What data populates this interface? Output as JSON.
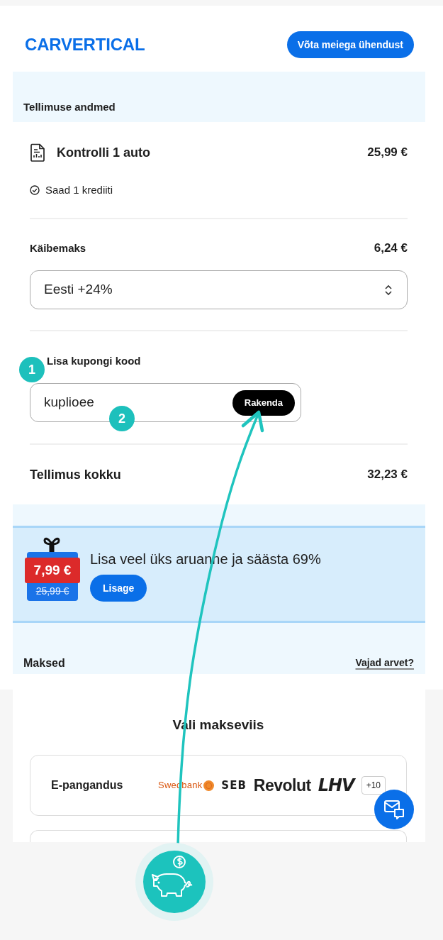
{
  "header": {
    "logo": "CARVERTICAL",
    "contact_button": "Võta meiega ühendust"
  },
  "order": {
    "title": "Tellimuse andmed",
    "product": {
      "name": "Kontrolli 1 auto",
      "price": "25,99 €",
      "note": "Saad 1 krediiti"
    },
    "vat": {
      "label": "Käibemaks",
      "amount": "6,24 €",
      "select_value": "Eesti +24%"
    },
    "coupon": {
      "label": "Lisa kupongi kood",
      "value": "kuplioee",
      "apply_button": "Rakenda"
    },
    "total": {
      "label": "Tellimus kokku",
      "amount": "32,23 €"
    }
  },
  "offer": {
    "new_price": "7,99 €",
    "old_price": "25,99 €",
    "text": "Lisa veel üks aruanne ja säästa 69%",
    "button": "Lisage"
  },
  "payments": {
    "title": "Maksed",
    "invoice_link": "Vajad arvet?",
    "heading": "Vali makseviis",
    "methods": [
      {
        "name": "E-pangandus",
        "logos": [
          {
            "kind": "coin",
            "text": "Swedbank"
          },
          {
            "kind": "ruled",
            "text": "SEB"
          },
          {
            "kind": "plain",
            "text": "Revolut"
          },
          {
            "kind": "slanted",
            "text": "LHV"
          }
        ],
        "more": "+10"
      }
    ]
  },
  "annotations": [
    {
      "label": "1"
    },
    {
      "label": "2"
    }
  ]
}
